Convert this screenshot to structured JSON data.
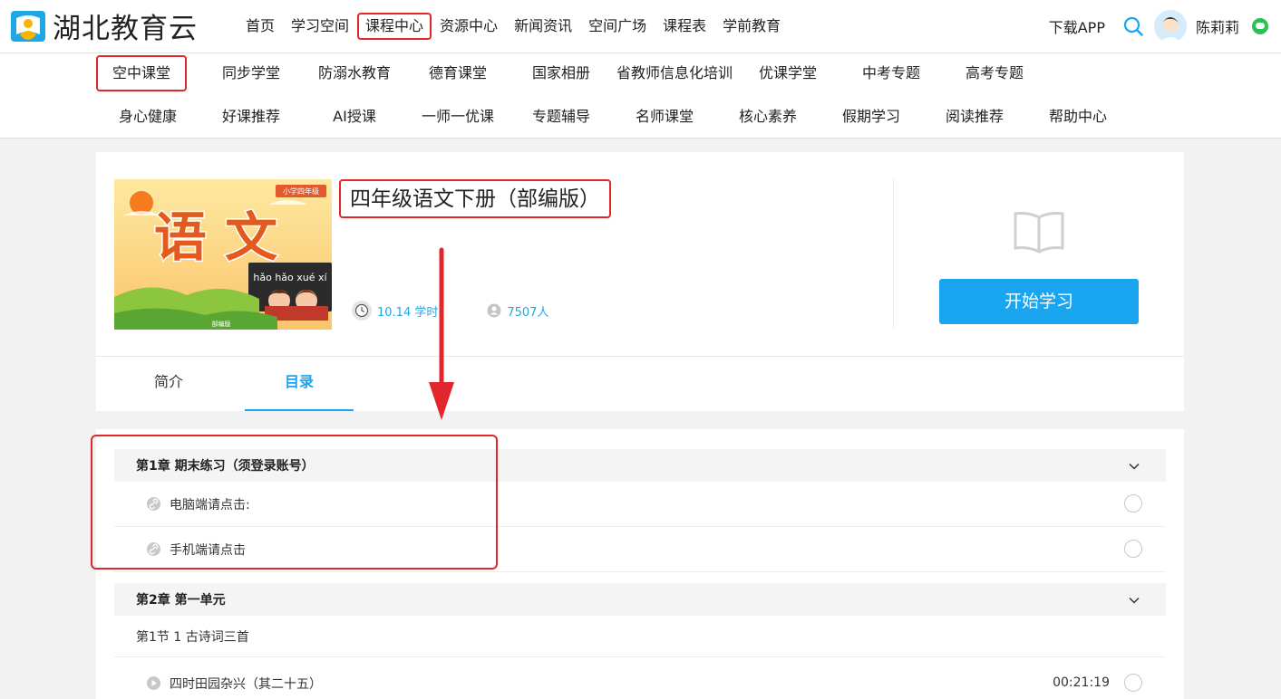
{
  "brand": {
    "name": "湖北教育云"
  },
  "topnav": {
    "items": [
      "首页",
      "学习空间",
      "课程中心",
      "资源中心",
      "新闻资讯",
      "空间广场",
      "课程表",
      "学前教育"
    ],
    "active": "课程中心"
  },
  "topright": {
    "download": "下载APP",
    "username": "陈莉莉"
  },
  "subnav": {
    "row1": [
      "空中课堂",
      "同步学堂",
      "防溺水教育",
      "德育课堂",
      "国家相册",
      "省教师信息化培训",
      "优课学堂",
      "中考专题",
      "高考专题"
    ],
    "row2": [
      "身心健康",
      "好课推荐",
      "AI授课",
      "一师一优课",
      "专题辅导",
      "名师课堂",
      "核心素养",
      "假期学习",
      "阅读推荐",
      "帮助中心"
    ],
    "active": "空中课堂"
  },
  "course": {
    "title": "四年级语文下册（部编版）",
    "hours": "10.14 学时",
    "learners": "7507人",
    "start_label": "开始学习",
    "cover": {
      "big_text": "语 文",
      "grade_badge": "小学四年级",
      "pinyin": "hǎo hǎo xué xí",
      "footer": "部编版"
    }
  },
  "tabs": {
    "intro": "简介",
    "toc": "目录",
    "active": "目录"
  },
  "catalog": {
    "chapter1": {
      "title": "第1章  期末练习（须登录账号）",
      "lessons": [
        "电脑端请点击:",
        "手机端请点击"
      ]
    },
    "chapter2": {
      "title": "第2章  第一单元",
      "section": "第1节  1 古诗词三首",
      "lesson": "四时田园杂兴（其二十五）",
      "duration": "00:21:19"
    }
  },
  "colors": {
    "accent": "#1aa5f0",
    "highlight": "#e1262c"
  }
}
